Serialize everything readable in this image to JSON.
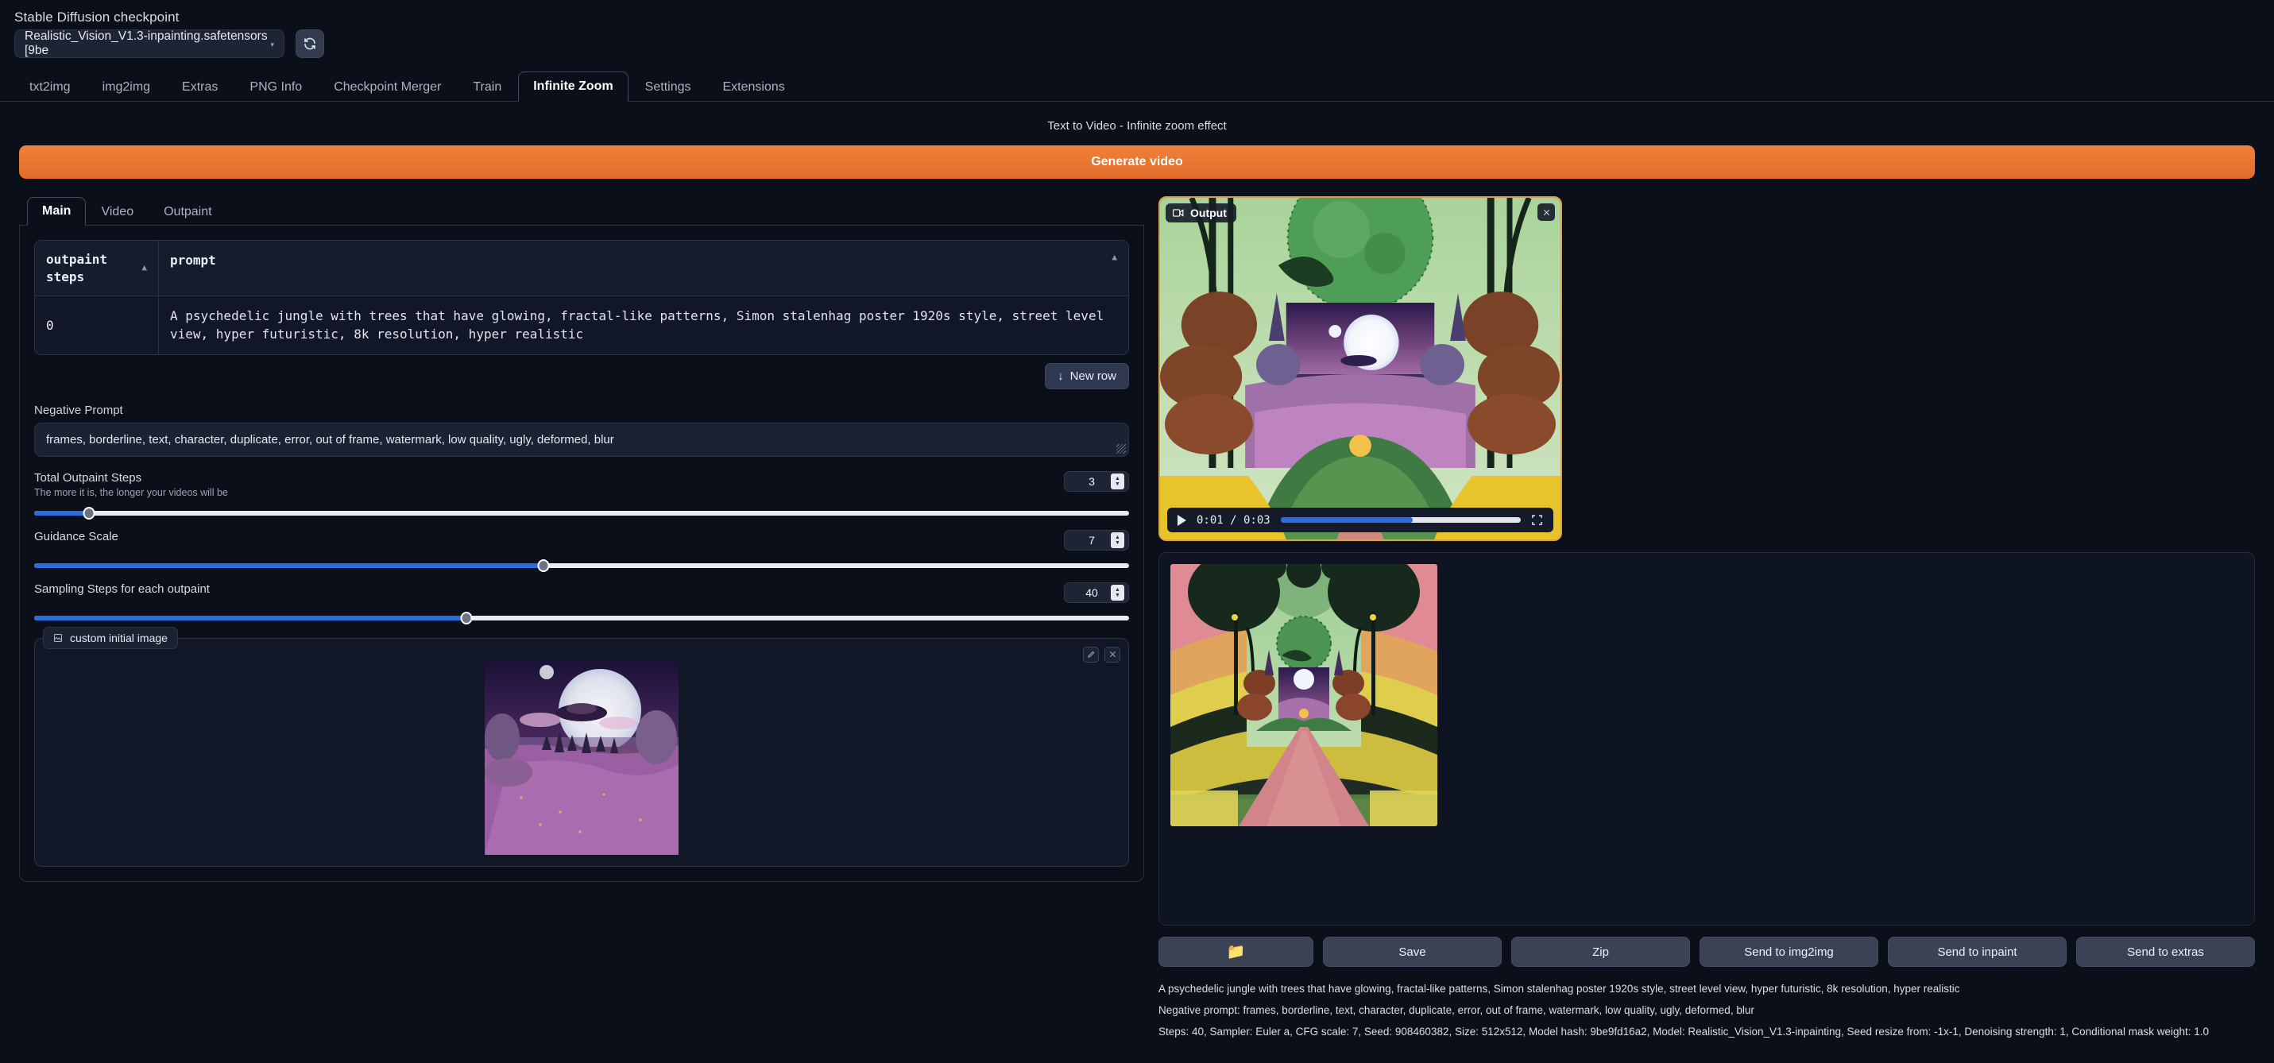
{
  "checkpoint": {
    "label": "Stable Diffusion checkpoint",
    "value": "Realistic_Vision_V1.3-inpainting.safetensors [9be",
    "caret": "▾",
    "refresh_icon": "refresh-icon"
  },
  "main_tabs": [
    {
      "label": "txt2img",
      "active": false
    },
    {
      "label": "img2img",
      "active": false
    },
    {
      "label": "Extras",
      "active": false
    },
    {
      "label": "PNG Info",
      "active": false
    },
    {
      "label": "Checkpoint Merger",
      "active": false
    },
    {
      "label": "Train",
      "active": false
    },
    {
      "label": "Infinite Zoom",
      "active": true
    },
    {
      "label": "Settings",
      "active": false
    },
    {
      "label": "Extensions",
      "active": false
    }
  ],
  "page_title": "Text to Video - Infinite zoom effect",
  "generate_button": "Generate video",
  "inner_tabs": [
    {
      "label": "Main",
      "active": true
    },
    {
      "label": "Video",
      "active": false
    },
    {
      "label": "Outpaint",
      "active": false
    }
  ],
  "prompt_table": {
    "col_steps": "outpaint steps",
    "col_prompt": "prompt",
    "sort_caret": "▲",
    "collapse_caret": "▲",
    "rows": [
      {
        "steps": "0",
        "prompt": "A psychedelic jungle with trees that have glowing, fractal-like patterns, Simon stalenhag poster 1920s style, street level view, hyper futuristic, 8k resolution, hyper realistic"
      }
    ],
    "new_row_button": "New row",
    "new_row_icon": "↓"
  },
  "negative_prompt": {
    "label": "Negative Prompt",
    "value": "frames, borderline, text, character, duplicate, error, out of frame, watermark, low quality, ugly, deformed, blur"
  },
  "sliders": [
    {
      "label": "Total Outpaint Steps",
      "sub": "The more it is, the longer your videos will be",
      "value": "3",
      "pct": 5
    },
    {
      "label": "Guidance Scale",
      "sub": "",
      "value": "7",
      "pct": 46.5
    },
    {
      "label": "Sampling Steps for each outpaint",
      "sub": "",
      "value": "40",
      "pct": 39.5
    }
  ],
  "init_image": {
    "tag": "custom initial image",
    "tag_icon": "image-icon",
    "edit_icon": "pencil-icon",
    "clear_icon": "close-icon"
  },
  "output": {
    "tag": "Output",
    "tag_icon": "video-icon",
    "close_icon": "close-icon",
    "player": {
      "play_icon": "play-icon",
      "time": "0:01 / 0:03",
      "fullscreen_icon": "fullscreen-icon",
      "progress_pct": 55
    }
  },
  "action_buttons": [
    {
      "label": "",
      "icon": "folder-icon",
      "name": "open-folder-button"
    },
    {
      "label": "Save",
      "icon": "",
      "name": "save-button"
    },
    {
      "label": "Zip",
      "icon": "",
      "name": "zip-button"
    },
    {
      "label": "Send to img2img",
      "icon": "",
      "name": "send-to-img2img-button"
    },
    {
      "label": "Send to inpaint",
      "icon": "",
      "name": "send-to-inpaint-button"
    },
    {
      "label": "Send to extras",
      "icon": "",
      "name": "send-to-extras-button"
    }
  ],
  "info_lines": [
    "A psychedelic jungle with trees that have glowing, fractal-like patterns, Simon stalenhag poster 1920s style, street level view, hyper futuristic, 8k resolution, hyper realistic",
    "Negative prompt: frames, borderline, text, character, duplicate, error, out of frame, watermark, low quality, ugly, deformed, blur",
    "Steps: 40, Sampler: Euler a, CFG scale: 7, Seed: 908460382, Size: 512x512, Model hash: 9be9fd16a2, Model: Realistic_Vision_V1.3-inpainting, Seed resize from: -1x-1, Denoising strength: 1, Conditional mask weight: 1.0"
  ],
  "colors": {
    "accent_orange": "#e8762c",
    "slider_blue": "#2a6ddb",
    "panel_bg": "#0b0f19",
    "video_border": "#d9a24a"
  }
}
